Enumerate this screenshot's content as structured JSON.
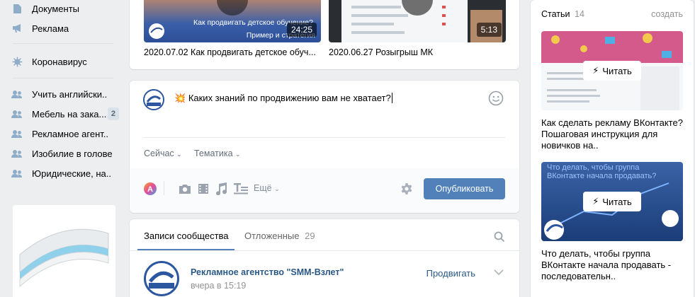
{
  "nav": {
    "items": [
      {
        "label": "Документы",
        "icon": "document-icon"
      },
      {
        "label": "Реклама",
        "icon": "megaphone-icon"
      },
      {
        "label": "Коронавирус",
        "icon": "virus-icon"
      },
      {
        "label": "Учить английски..",
        "icon": "group-icon"
      },
      {
        "label": "Мебель на зака...",
        "icon": "group-icon",
        "count": "2"
      },
      {
        "label": "Рекламное агент..",
        "icon": "group-icon"
      },
      {
        "label": "Изобилие в голове",
        "icon": "group-icon"
      },
      {
        "label": "Юридические, на..",
        "icon": "group-icon"
      }
    ]
  },
  "videos": [
    {
      "caption": "2020.07.02 Как продвигать детское обуч...",
      "duration": "24:25",
      "overlay_line1": "Как продвигать детское обучение?",
      "overlay_line2": "Пример и стратегия"
    },
    {
      "caption": "2020.06.27 Розыгрыш МК",
      "duration": "5:13"
    }
  ],
  "composer": {
    "emoji": "💥",
    "text": "Каких знаний по продвижению вам не хватает?",
    "when_label": "Сейчас",
    "topic_label": "Тематика",
    "more_label": "Ещё",
    "publish_label": "Опубликовать"
  },
  "wall": {
    "tab_posts": "Записи сообщества",
    "tab_postponed": "Отложенные",
    "postponed_count": "29",
    "post_author": "Рекламное агентство \"SMM-Взлет\"",
    "post_time": "вчера в 15:19",
    "promote_label": "Продвигать"
  },
  "articles": {
    "header": "Статьи",
    "count": "14",
    "create_label": "создать",
    "read_label": "Читать",
    "items": [
      {
        "title": "Как сделать рекламу ВКонтакте? Пошаговая инструкция для новичков на.."
      },
      {
        "title": "Что делать, чтобы группа ВКонтакте начала продавать - последовательн..",
        "image_text": "Что делать, чтобы группа ВКонтакте начала продавать?"
      }
    ]
  },
  "colors": {
    "accent": "#5181b8",
    "background": "#edeef0",
    "icon": "#8fadc8"
  }
}
